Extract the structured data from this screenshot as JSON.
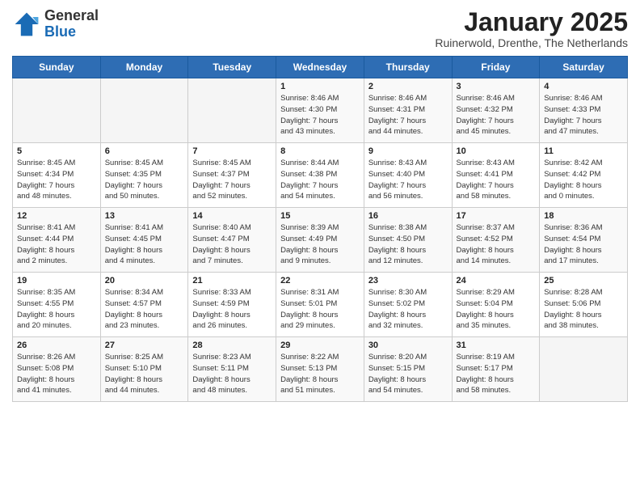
{
  "header": {
    "logo_general": "General",
    "logo_blue": "Blue",
    "month_title": "January 2025",
    "location": "Ruinerwold, Drenthe, The Netherlands"
  },
  "weekdays": [
    "Sunday",
    "Monday",
    "Tuesday",
    "Wednesday",
    "Thursday",
    "Friday",
    "Saturday"
  ],
  "weeks": [
    [
      {
        "day": "",
        "info": ""
      },
      {
        "day": "",
        "info": ""
      },
      {
        "day": "",
        "info": ""
      },
      {
        "day": "1",
        "info": "Sunrise: 8:46 AM\nSunset: 4:30 PM\nDaylight: 7 hours\nand 43 minutes."
      },
      {
        "day": "2",
        "info": "Sunrise: 8:46 AM\nSunset: 4:31 PM\nDaylight: 7 hours\nand 44 minutes."
      },
      {
        "day": "3",
        "info": "Sunrise: 8:46 AM\nSunset: 4:32 PM\nDaylight: 7 hours\nand 45 minutes."
      },
      {
        "day": "4",
        "info": "Sunrise: 8:46 AM\nSunset: 4:33 PM\nDaylight: 7 hours\nand 47 minutes."
      }
    ],
    [
      {
        "day": "5",
        "info": "Sunrise: 8:45 AM\nSunset: 4:34 PM\nDaylight: 7 hours\nand 48 minutes."
      },
      {
        "day": "6",
        "info": "Sunrise: 8:45 AM\nSunset: 4:35 PM\nDaylight: 7 hours\nand 50 minutes."
      },
      {
        "day": "7",
        "info": "Sunrise: 8:45 AM\nSunset: 4:37 PM\nDaylight: 7 hours\nand 52 minutes."
      },
      {
        "day": "8",
        "info": "Sunrise: 8:44 AM\nSunset: 4:38 PM\nDaylight: 7 hours\nand 54 minutes."
      },
      {
        "day": "9",
        "info": "Sunrise: 8:43 AM\nSunset: 4:40 PM\nDaylight: 7 hours\nand 56 minutes."
      },
      {
        "day": "10",
        "info": "Sunrise: 8:43 AM\nSunset: 4:41 PM\nDaylight: 7 hours\nand 58 minutes."
      },
      {
        "day": "11",
        "info": "Sunrise: 8:42 AM\nSunset: 4:42 PM\nDaylight: 8 hours\nand 0 minutes."
      }
    ],
    [
      {
        "day": "12",
        "info": "Sunrise: 8:41 AM\nSunset: 4:44 PM\nDaylight: 8 hours\nand 2 minutes."
      },
      {
        "day": "13",
        "info": "Sunrise: 8:41 AM\nSunset: 4:45 PM\nDaylight: 8 hours\nand 4 minutes."
      },
      {
        "day": "14",
        "info": "Sunrise: 8:40 AM\nSunset: 4:47 PM\nDaylight: 8 hours\nand 7 minutes."
      },
      {
        "day": "15",
        "info": "Sunrise: 8:39 AM\nSunset: 4:49 PM\nDaylight: 8 hours\nand 9 minutes."
      },
      {
        "day": "16",
        "info": "Sunrise: 8:38 AM\nSunset: 4:50 PM\nDaylight: 8 hours\nand 12 minutes."
      },
      {
        "day": "17",
        "info": "Sunrise: 8:37 AM\nSunset: 4:52 PM\nDaylight: 8 hours\nand 14 minutes."
      },
      {
        "day": "18",
        "info": "Sunrise: 8:36 AM\nSunset: 4:54 PM\nDaylight: 8 hours\nand 17 minutes."
      }
    ],
    [
      {
        "day": "19",
        "info": "Sunrise: 8:35 AM\nSunset: 4:55 PM\nDaylight: 8 hours\nand 20 minutes."
      },
      {
        "day": "20",
        "info": "Sunrise: 8:34 AM\nSunset: 4:57 PM\nDaylight: 8 hours\nand 23 minutes."
      },
      {
        "day": "21",
        "info": "Sunrise: 8:33 AM\nSunset: 4:59 PM\nDaylight: 8 hours\nand 26 minutes."
      },
      {
        "day": "22",
        "info": "Sunrise: 8:31 AM\nSunset: 5:01 PM\nDaylight: 8 hours\nand 29 minutes."
      },
      {
        "day": "23",
        "info": "Sunrise: 8:30 AM\nSunset: 5:02 PM\nDaylight: 8 hours\nand 32 minutes."
      },
      {
        "day": "24",
        "info": "Sunrise: 8:29 AM\nSunset: 5:04 PM\nDaylight: 8 hours\nand 35 minutes."
      },
      {
        "day": "25",
        "info": "Sunrise: 8:28 AM\nSunset: 5:06 PM\nDaylight: 8 hours\nand 38 minutes."
      }
    ],
    [
      {
        "day": "26",
        "info": "Sunrise: 8:26 AM\nSunset: 5:08 PM\nDaylight: 8 hours\nand 41 minutes."
      },
      {
        "day": "27",
        "info": "Sunrise: 8:25 AM\nSunset: 5:10 PM\nDaylight: 8 hours\nand 44 minutes."
      },
      {
        "day": "28",
        "info": "Sunrise: 8:23 AM\nSunset: 5:11 PM\nDaylight: 8 hours\nand 48 minutes."
      },
      {
        "day": "29",
        "info": "Sunrise: 8:22 AM\nSunset: 5:13 PM\nDaylight: 8 hours\nand 51 minutes."
      },
      {
        "day": "30",
        "info": "Sunrise: 8:20 AM\nSunset: 5:15 PM\nDaylight: 8 hours\nand 54 minutes."
      },
      {
        "day": "31",
        "info": "Sunrise: 8:19 AM\nSunset: 5:17 PM\nDaylight: 8 hours\nand 58 minutes."
      },
      {
        "day": "",
        "info": ""
      }
    ]
  ]
}
